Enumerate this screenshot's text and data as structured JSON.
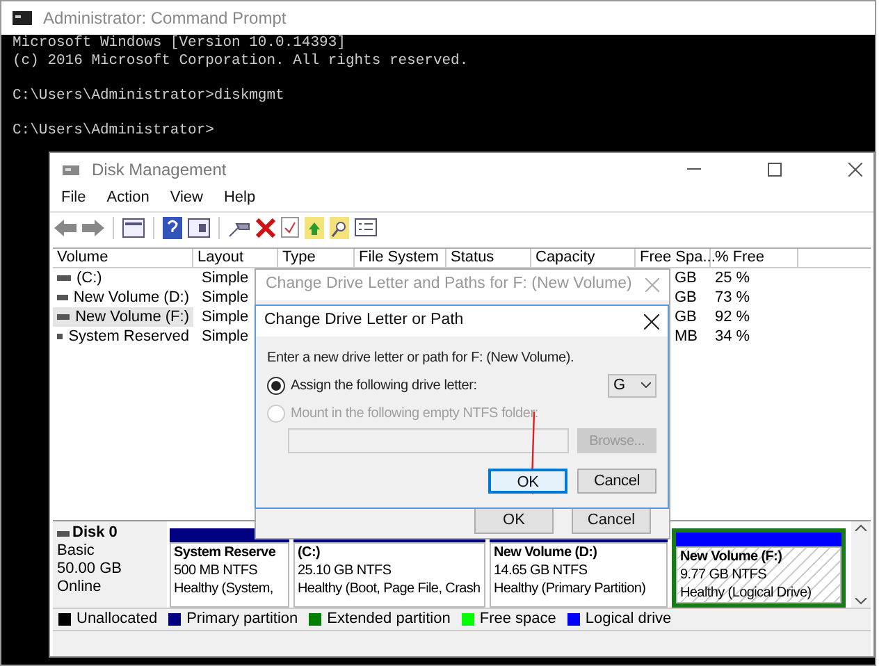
{
  "console": {
    "title": "Administrator: Command Prompt",
    "paragraphs": [
      [
        "Microsoft Windows [Version 10.0.14393]",
        "(c) 2016 Microsoft Corporation. All rights reserved."
      ],
      [
        "C:\\Users\\Administrator>diskmgmt"
      ],
      [
        "C:\\Users\\Administrator>"
      ]
    ]
  },
  "disk_management": {
    "title": "Disk Management",
    "menu": [
      "File",
      "Action",
      "View",
      "Help"
    ],
    "columns": [
      "Volume",
      "Layout",
      "Type",
      "File System",
      "Status",
      "Capacity",
      "Free Spa...",
      "% Free"
    ],
    "rows": [
      {
        "volume": "(C:)",
        "layout": "Simple",
        "free_space": "GB",
        "percent_free": "25 %",
        "selected": false
      },
      {
        "volume": "New Volume (D:)",
        "layout": "Simple",
        "free_space": "GB",
        "percent_free": "73 %",
        "selected": false
      },
      {
        "volume": "New Volume (F:)",
        "layout": "Simple",
        "free_space": "GB",
        "percent_free": "92 %",
        "selected": true
      },
      {
        "volume": "System Reserved",
        "layout": "Simple",
        "free_space": "MB",
        "percent_free": "34 %",
        "selected": false
      }
    ],
    "disk": {
      "name": "Disk 0",
      "type": "Basic",
      "size": "50.00 GB",
      "status": "Online"
    },
    "partitions": [
      {
        "name": "System Reserve",
        "size": "500 MB NTFS",
        "status": "Healthy (System,",
        "color": "#000080",
        "selected": false
      },
      {
        "name": "(C:)",
        "size": "25.10 GB NTFS",
        "status": "Healthy (Boot, Page File, Crash",
        "color": "#000080",
        "selected": false
      },
      {
        "name": "New Volume  (D:)",
        "size": "14.65 GB NTFS",
        "status": "Healthy (Primary Partition)",
        "color": "#000080",
        "selected": false
      },
      {
        "name": "New Volume  (F:)",
        "size": "9.77 GB NTFS",
        "status": "Healthy (Logical Drive)",
        "color": "#0000ff",
        "selected": true
      }
    ],
    "legend": [
      {
        "label": "Unallocated",
        "color": "#000000"
      },
      {
        "label": "Primary partition",
        "color": "#000080"
      },
      {
        "label": "Extended partition",
        "color": "#008000"
      },
      {
        "label": "Free space",
        "color": "#00ff00"
      },
      {
        "label": "Logical drive",
        "color": "#0000ff"
      }
    ]
  },
  "paths_dialog": {
    "title": "Change Drive Letter and Paths for F: (New Volume)",
    "buttons": [
      "OK",
      "Cancel"
    ]
  },
  "letter_dialog": {
    "title": "Change Drive Letter or Path",
    "prompt": "Enter a new drive letter or path for F: (New Volume).",
    "options": [
      {
        "label": "Assign the following drive letter:",
        "selected": true,
        "disabled": false
      },
      {
        "label": "Mount in the following empty NTFS folder:",
        "selected": false,
        "disabled": true
      }
    ],
    "drive_letter": "G",
    "browse": "Browse...",
    "buttons": [
      "OK",
      "Cancel"
    ]
  }
}
